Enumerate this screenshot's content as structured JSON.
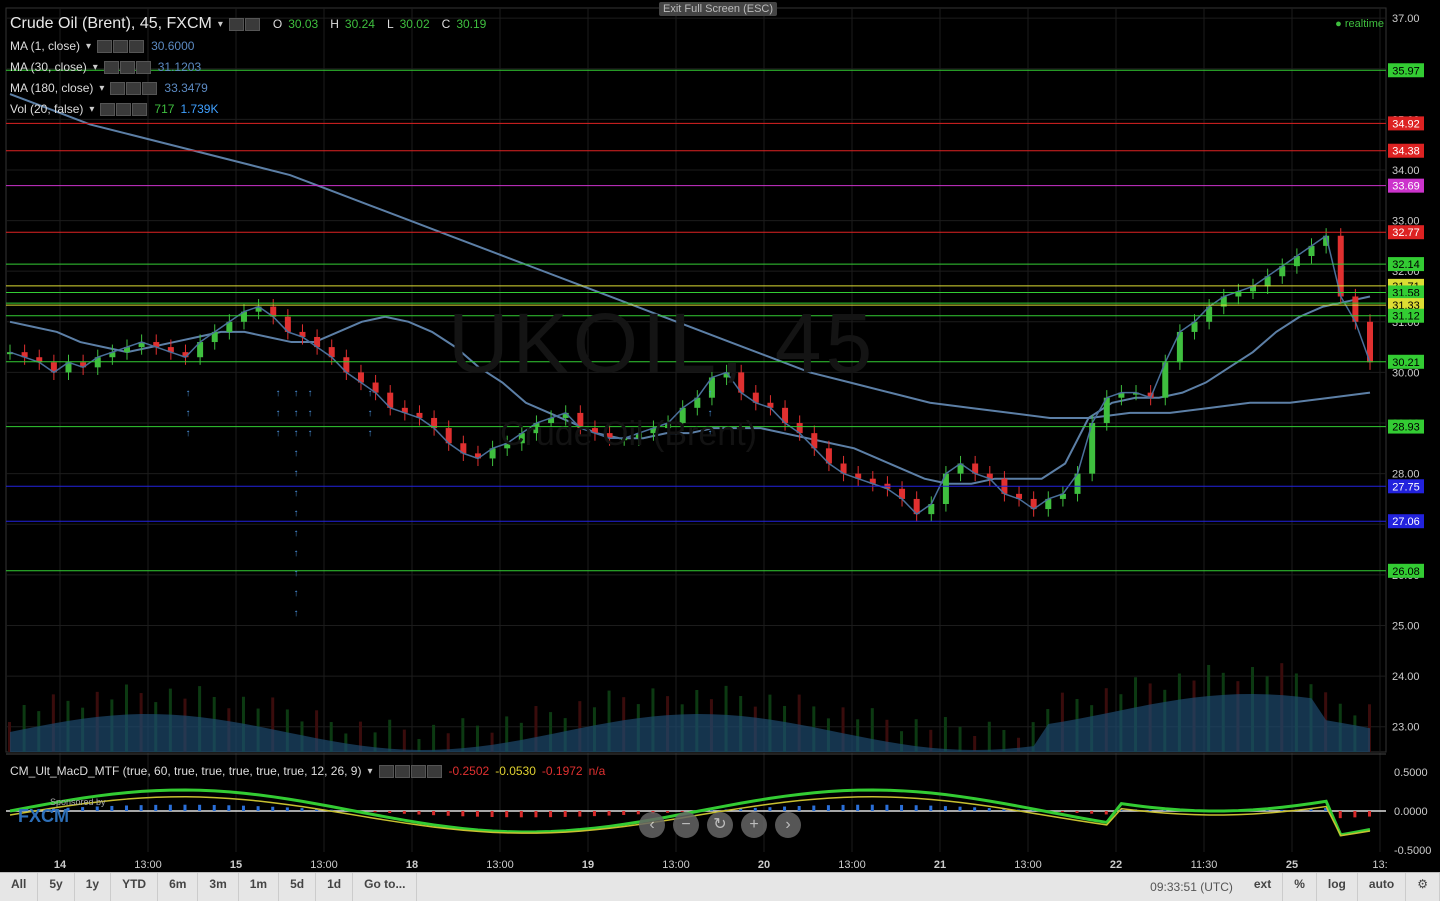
{
  "header": {
    "title": "Crude Oil (Brent), 45, FXCM",
    "ohlc": [
      {
        "label": "O",
        "value": "30.03"
      },
      {
        "label": "H",
        "value": "30.24"
      },
      {
        "label": "L",
        "value": "30.02"
      },
      {
        "label": "C",
        "value": "30.19"
      }
    ],
    "exit_fullscreen": "Exit Full Screen (ESC)",
    "realtime": "realtime",
    "watermark_symbol": "UKOIL, 45",
    "watermark_desc": "Crude Oil (Brent)"
  },
  "indicators": [
    {
      "label": "MA (1, close)",
      "value": "30.6000"
    },
    {
      "label": "MA (30, close)",
      "value": "31.1203"
    },
    {
      "label": "MA (180, close)",
      "value": "33.3479"
    },
    {
      "label": "Vol (20, false)",
      "value": "717",
      "value2": "1.739K"
    }
  ],
  "macd": {
    "label": "CM_Ult_MacD_MTF (true, 60, true, true, true, true, true, 12, 26, 9)",
    "v1": "-0.2502",
    "v2": "-0.0530",
    "v3": "-0.1972",
    "v4": "n/a",
    "axis": [
      "0.5000",
      "0.0000",
      "-0.5000"
    ],
    "sponsor": "Sponsored by",
    "sponsor_brand": "FXCM"
  },
  "colors": {
    "bg": "#000000",
    "up": "#3fbf3f",
    "down": "#e03030",
    "ma": "#5c7fa6",
    "green_line": "#33cc33",
    "red_line": "#dd2222",
    "magenta_line": "#cc33cc",
    "yellow_line": "#dddd33",
    "blue_line": "#2222dd",
    "arrow": "#4a8fd8"
  },
  "chart_data": {
    "type": "candlestick",
    "price_axis": {
      "min": 22.5,
      "max": 37.2,
      "ticks": [
        "37.00",
        "36.00",
        "35.00",
        "34.00",
        "33.00",
        "32.00",
        "31.00",
        "30.00",
        "29.00",
        "28.00",
        "27.00",
        "26.00",
        "25.00",
        "24.00",
        "23.00"
      ]
    },
    "time_axis": [
      "14",
      "13:00",
      "15",
      "13:00",
      "18",
      "13:00",
      "19",
      "13:00",
      "20",
      "13:00",
      "21",
      "13:00",
      "22",
      "11:30",
      "25",
      "13:"
    ],
    "price_close_trace": [
      30.4,
      30.3,
      30.2,
      30.0,
      30.2,
      30.1,
      30.3,
      30.4,
      30.5,
      30.6,
      30.5,
      30.4,
      30.3,
      30.6,
      30.8,
      31.0,
      31.2,
      31.3,
      31.1,
      30.8,
      30.7,
      30.5,
      30.3,
      30.0,
      29.8,
      29.6,
      29.3,
      29.2,
      29.1,
      28.9,
      28.6,
      28.4,
      28.3,
      28.5,
      28.6,
      28.8,
      29.0,
      29.1,
      29.2,
      28.9,
      28.8,
      28.7,
      28.7,
      28.8,
      28.9,
      29.0,
      29.3,
      29.5,
      29.9,
      30.0,
      29.6,
      29.4,
      29.3,
      29.0,
      28.8,
      28.5,
      28.2,
      28.0,
      27.9,
      27.8,
      27.7,
      27.5,
      27.2,
      27.4,
      28.0,
      28.2,
      28.0,
      27.9,
      27.6,
      27.5,
      27.3,
      27.5,
      27.6,
      28.0,
      29.0,
      29.5,
      29.6,
      29.6,
      29.5,
      30.2,
      30.8,
      31.0,
      31.3,
      31.5,
      31.6,
      31.7,
      31.9,
      32.1,
      32.3,
      32.5,
      32.7,
      31.5,
      31.0,
      30.2
    ],
    "ma30_trace": [
      31.0,
      30.9,
      30.8,
      30.6,
      30.5,
      30.4,
      30.5,
      30.6,
      30.7,
      30.8,
      30.8,
      30.7,
      30.6,
      30.6,
      30.8,
      31.0,
      31.1,
      31.0,
      30.8,
      30.5,
      30.1,
      29.8,
      29.4,
      29.2,
      29.0,
      28.8,
      28.7,
      28.7,
      28.8,
      28.8,
      28.9,
      28.9,
      28.9,
      28.8,
      28.7,
      28.6,
      28.5,
      28.3,
      28.1,
      27.9,
      27.8,
      27.8,
      27.9,
      27.9,
      27.9,
      28.2,
      29.1,
      29.4,
      29.5,
      29.5,
      29.6,
      29.8,
      30.1,
      30.4,
      30.8,
      31.1,
      31.3,
      31.4,
      31.5
    ],
    "ma180_trace": [
      35.5,
      35.2,
      34.9,
      34.7,
      34.5,
      34.3,
      34.1,
      33.9,
      33.6,
      33.3,
      33.0,
      32.7,
      32.4,
      32.1,
      31.8,
      31.5,
      31.2,
      30.9,
      30.6,
      30.3,
      30.0,
      29.8,
      29.6,
      29.4,
      29.3,
      29.2,
      29.1,
      29.1,
      29.2,
      29.2,
      29.3,
      29.4,
      29.4,
      29.5,
      29.6
    ],
    "horizontal_levels": [
      {
        "value": "35.97",
        "color": "#33cc33"
      },
      {
        "value": "34.92",
        "color": "#dd2222"
      },
      {
        "value": "34.38",
        "color": "#dd2222"
      },
      {
        "value": "33.69",
        "color": "#cc33cc"
      },
      {
        "value": "32.77",
        "color": "#dd2222"
      },
      {
        "value": "32.14",
        "color": "#33cc33"
      },
      {
        "value": "31.71",
        "color": "#dddd33"
      },
      {
        "value": "31.58",
        "color": "#33cc33"
      },
      {
        "value": "31.37",
        "color": "#33cc33"
      },
      {
        "value": "26.08",
        "color": "#33cc33"
      },
      {
        "value": "31.33",
        "color": "#dddd33"
      },
      {
        "value": "31.12",
        "color": "#33cc33"
      },
      {
        "value": "30.21",
        "color": "#33cc33"
      },
      {
        "value": "28.93",
        "color": "#33cc33"
      },
      {
        "value": "27.75",
        "color": "#2222dd"
      },
      {
        "value": "27.06",
        "color": "#2222dd"
      }
    ]
  },
  "bottom_bar": {
    "ranges": [
      "All",
      "5y",
      "1y",
      "YTD",
      "6m",
      "3m",
      "1m",
      "5d",
      "1d",
      "Go to..."
    ],
    "time": "09:33:51 (UTC)",
    "right": [
      "ext",
      "%",
      "log",
      "auto"
    ]
  }
}
